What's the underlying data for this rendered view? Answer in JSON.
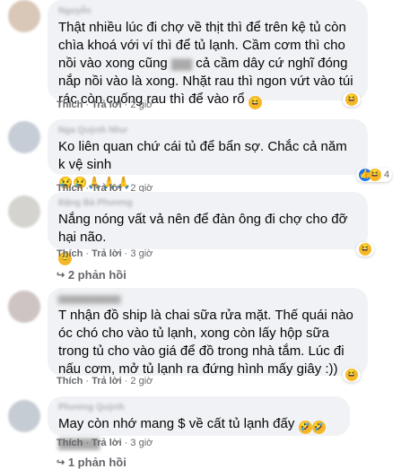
{
  "comments": [
    {
      "author": "Nguyễn",
      "text": "Thật nhiều lúc đi chợ về thịt thì để trên kệ tủ còn chìa khoá với ví thì để tủ lạnh. Cầm cơm thì cho nồi vào xong cũng",
      "text2": "cả cầm dây cứ nghĩ đóng nắp nồi vào là xong. Nhặt rau thì ngon vứt vào túi rác còn cuống rau thì để vào rổ",
      "like": "Thích",
      "reply": "Trả lời",
      "time": "2 giờ",
      "reactions": ""
    },
    {
      "author": "Nga Quỳnh Như",
      "text": "Ko liên quan chứ cái tủ để bẩn sợ. Chắc cả năm k vệ sinh",
      "like": "Thích",
      "reply": "Trả lời",
      "time": "2 giờ",
      "reactions": "4"
    },
    {
      "author": "Đặng Bá Phương",
      "text": "Nắng nóng vất vả nên để đàn ông đi chợ cho đỡ hại não.",
      "like": "Thích",
      "reply": "Trả lời",
      "time": "3 giờ",
      "replies": "2 phản hồi"
    },
    {
      "author": "",
      "text": "T nhận đồ ship là chai sữa rửa mặt. Thế quái nào óc chó cho vào tủ lạnh, xong còn lấy hộp sữa trong tủ cho vào giá để đồ trong nhà tắm. Lúc đi nấu cơm, mở tủ lạnh ra đứng hình mấy giây :))",
      "like": "Thích",
      "reply": "Trả lời",
      "time": "2 giờ"
    },
    {
      "author": "Phương Quỳnh",
      "text": "May còn nhớ mang $ về cất tủ lạnh đấy",
      "like": "Thích",
      "reply": "Trả lời",
      "time": "3 giờ",
      "replies": "1 phản hồi"
    }
  ],
  "icons": {
    "haha": "haha-icon",
    "like": "like-icon",
    "replies": "reply-arrow-icon"
  },
  "colors": {
    "bubble": "#f0f2f5",
    "meta": "#65676b",
    "haha": "#f7b928",
    "like": "#1877f2"
  }
}
